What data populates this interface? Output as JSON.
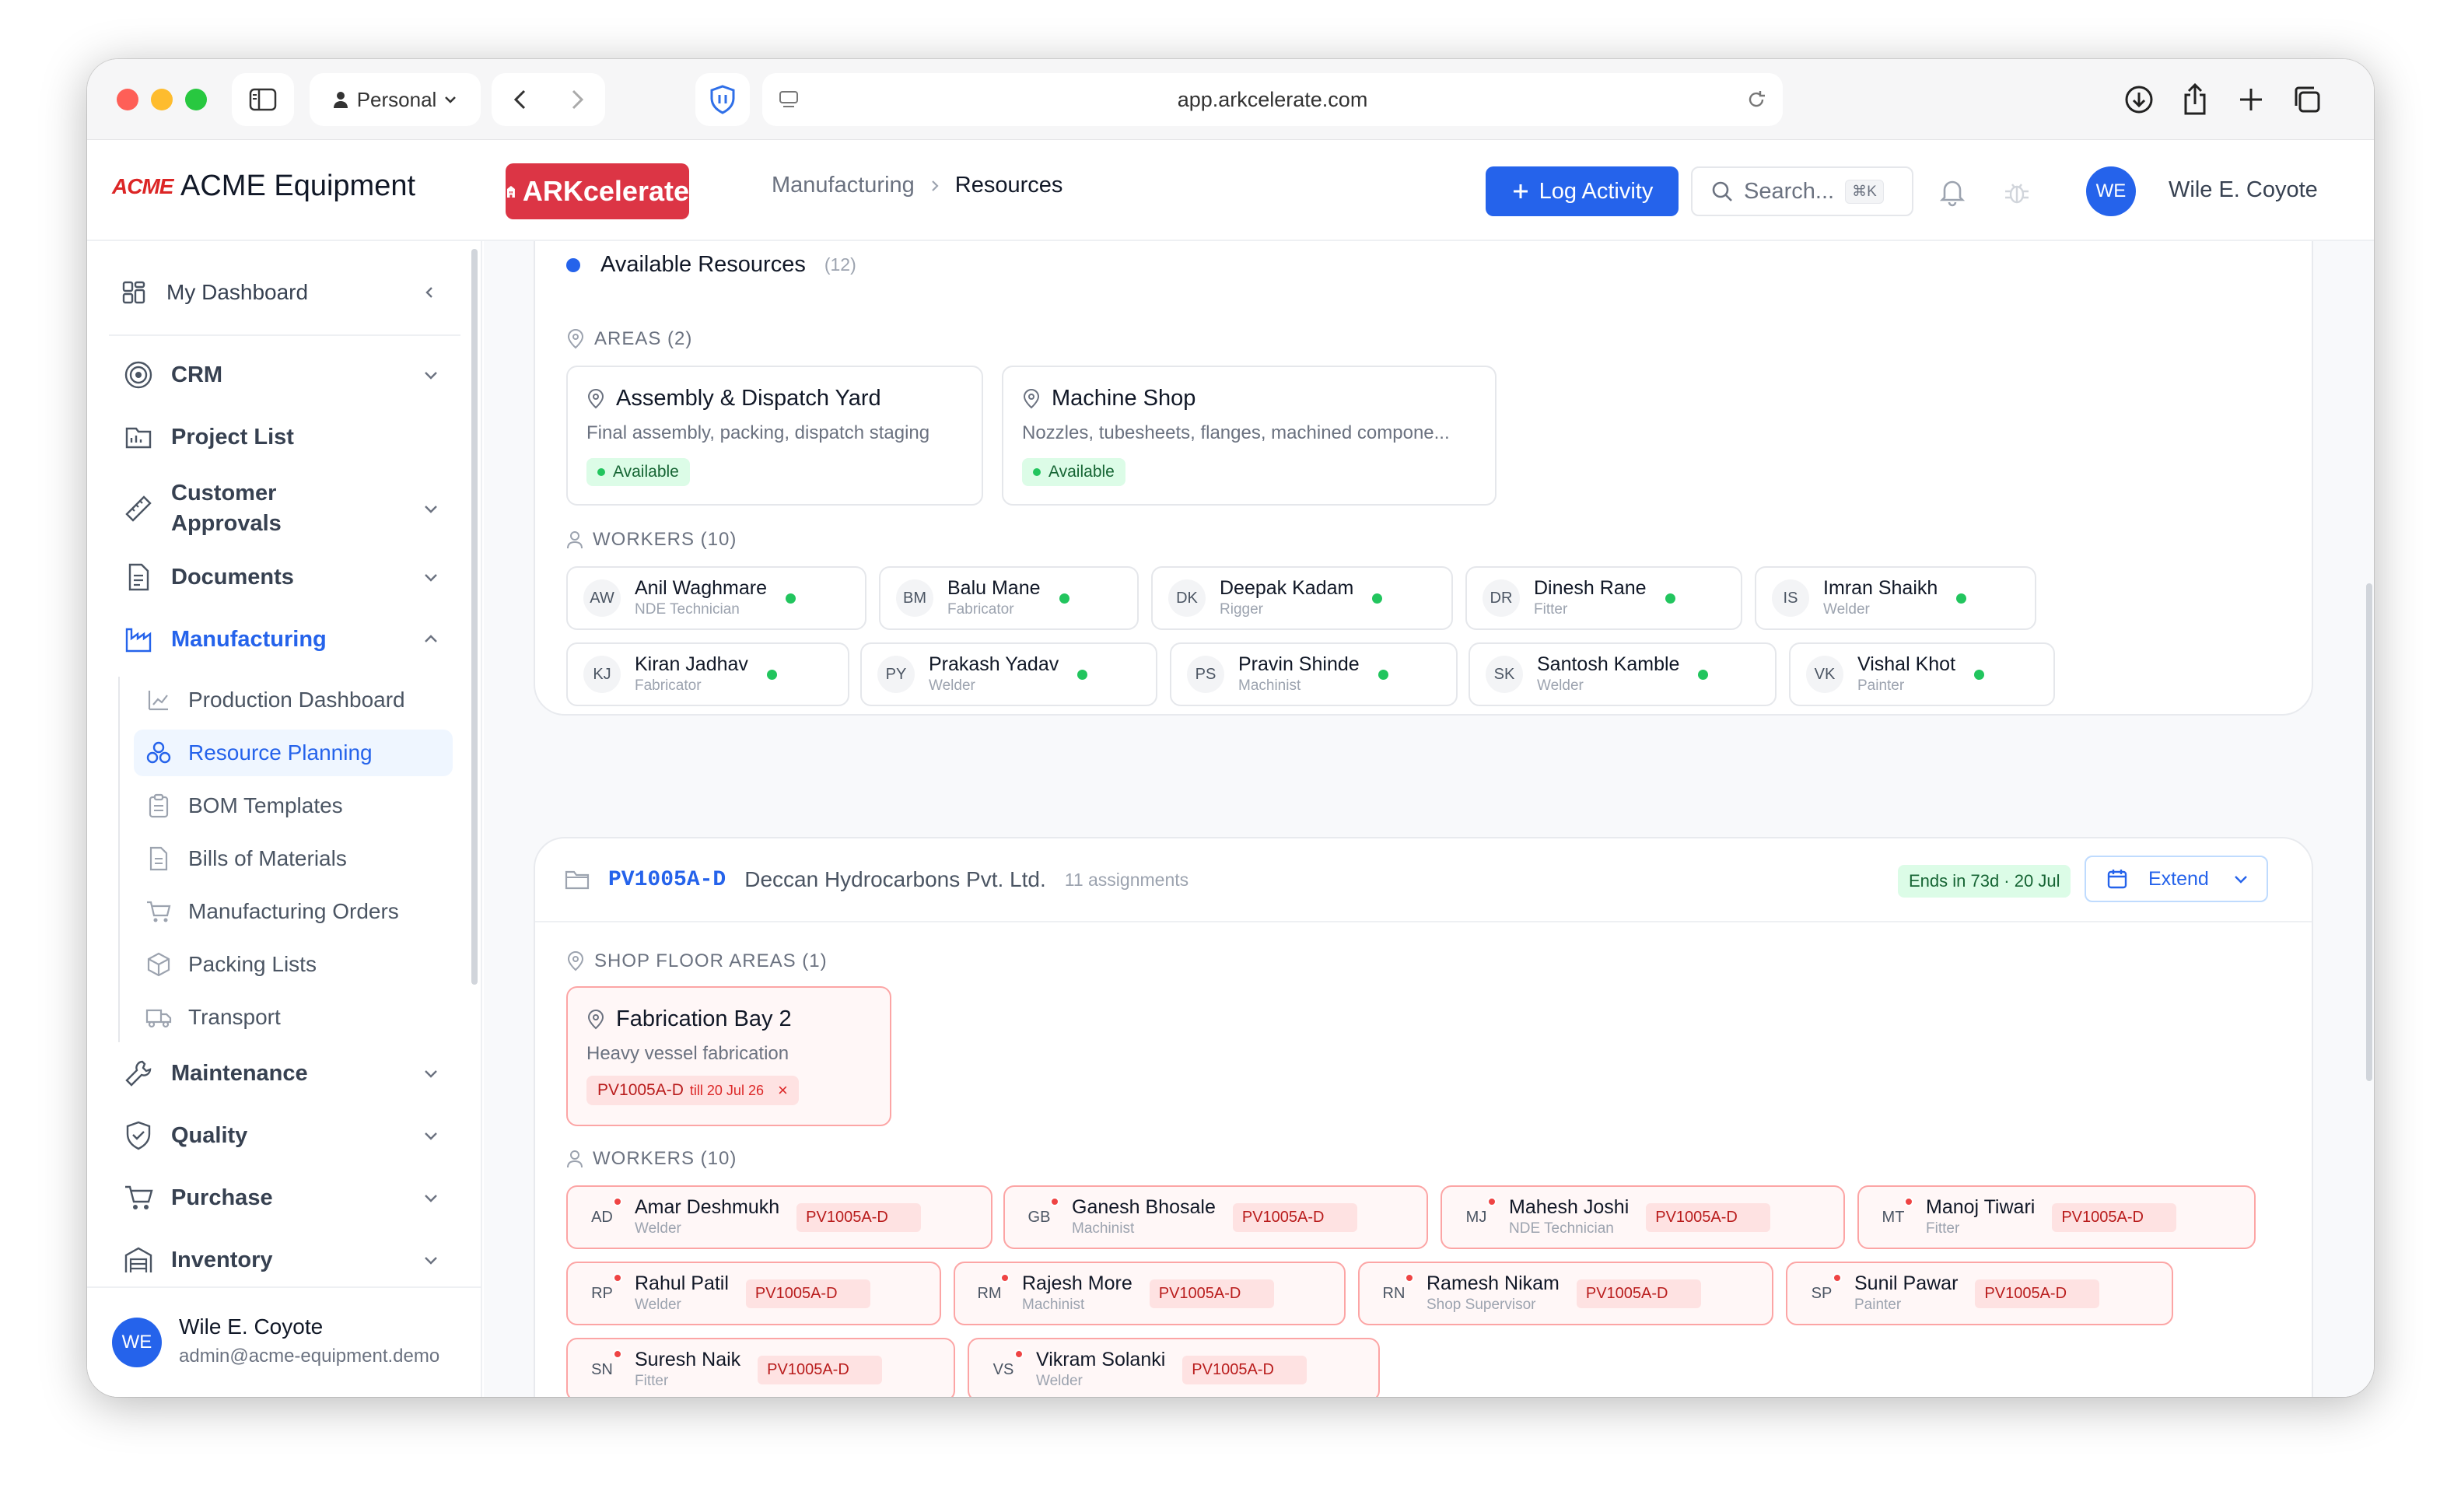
{
  "browser": {
    "profile": "Personal",
    "url": "app.arkcelerate.com"
  },
  "org": {
    "logo_text": "ACME",
    "name": "ACME Equipment"
  },
  "app": {
    "brand": "ARKcelerate",
    "brand_color": "#dc3545"
  },
  "breadcrumb": [
    "Manufacturing",
    "Resources"
  ],
  "header": {
    "log_activity_label": "Log Activity",
    "search_placeholder": "Search...",
    "search_shortcut": "⌘K",
    "user_initials": "WE",
    "user_name": "Wile E. Coyote"
  },
  "sidebar": {
    "dashboard": "My Dashboard",
    "items": [
      {
        "label": "CRM",
        "icon": "target-icon",
        "has_chevron": true
      },
      {
        "label": "Project List",
        "icon": "project-icon",
        "has_chevron": false
      },
      {
        "label": "Customer\nApprovals",
        "icon": "ruler-icon",
        "has_chevron": true
      },
      {
        "label": "Documents",
        "icon": "document-icon",
        "has_chevron": true
      },
      {
        "label": "Manufacturing",
        "icon": "factory-icon",
        "has_chevron": true,
        "expanded": true
      },
      {
        "label": "Maintenance",
        "icon": "wrench-icon",
        "has_chevron": true
      },
      {
        "label": "Quality",
        "icon": "shield-check-icon",
        "has_chevron": true
      },
      {
        "label": "Purchase",
        "icon": "cart-icon",
        "has_chevron": true
      },
      {
        "label": "Inventory",
        "icon": "warehouse-icon",
        "has_chevron": true
      }
    ],
    "manufacturing_sub": [
      {
        "label": "Production Dashboard",
        "icon": "chart-icon"
      },
      {
        "label": "Resource Planning",
        "icon": "resource-icon",
        "active": true
      },
      {
        "label": "BOM Templates",
        "icon": "clipboard-icon"
      },
      {
        "label": "Bills of Materials",
        "icon": "file-icon"
      },
      {
        "label": "Manufacturing Orders",
        "icon": "cart-icon"
      },
      {
        "label": "Packing Lists",
        "icon": "package-icon"
      },
      {
        "label": "Transport",
        "icon": "truck-icon"
      }
    ],
    "footer": {
      "initials": "WE",
      "name": "Wile E. Coyote",
      "email": "admin@acme-equipment.demo"
    }
  },
  "available": {
    "title": "Available Resources",
    "count": "(12)",
    "areas_label": "AREAS (2)",
    "areas": [
      {
        "name": "Assembly & Dispatch Yard",
        "desc": "Final assembly, packing, dispatch staging",
        "status": "Available"
      },
      {
        "name": "Machine Shop",
        "desc": "Nozzles, tubesheets, flanges, machined compone...",
        "status": "Available"
      }
    ],
    "workers_label": "WORKERS (10)",
    "workers": [
      {
        "initials": "AW",
        "name": "Anil Waghmare",
        "role": "NDE Technician"
      },
      {
        "initials": "BM",
        "name": "Balu Mane",
        "role": "Fabricator"
      },
      {
        "initials": "DK",
        "name": "Deepak Kadam",
        "role": "Rigger"
      },
      {
        "initials": "DR",
        "name": "Dinesh Rane",
        "role": "Fitter"
      },
      {
        "initials": "IS",
        "name": "Imran Shaikh",
        "role": "Welder"
      },
      {
        "initials": "KJ",
        "name": "Kiran Jadhav",
        "role": "Fabricator"
      },
      {
        "initials": "PY",
        "name": "Prakash Yadav",
        "role": "Welder"
      },
      {
        "initials": "PS",
        "name": "Pravin Shinde",
        "role": "Machinist"
      },
      {
        "initials": "SK",
        "name": "Santosh Kamble",
        "role": "Welder"
      },
      {
        "initials": "VK",
        "name": "Vishal Khot",
        "role": "Painter"
      }
    ]
  },
  "project": {
    "code": "PV1005A-D",
    "client": "Deccan Hydrocarbons Pvt. Ltd.",
    "assignments": "11 assignments",
    "ends_badge": "Ends in 73d · 20 Jul",
    "extend_label": "Extend",
    "areas_label": "SHOP FLOOR AREAS (1)",
    "area": {
      "name": "Fabrication Bay 2",
      "desc": "Heavy vessel fabrication",
      "tag_code": "PV1005A-D",
      "tag_till": "till 20 Jul 26",
      "tag_close": "×"
    },
    "workers_label": "WORKERS (10)",
    "workers": [
      {
        "initials": "AD",
        "name": "Amar Deshmukh",
        "role": "Welder",
        "tag": "PV1005A-D"
      },
      {
        "initials": "GB",
        "name": "Ganesh Bhosale",
        "role": "Machinist",
        "tag": "PV1005A-D"
      },
      {
        "initials": "MJ",
        "name": "Mahesh Joshi",
        "role": "NDE Technician",
        "tag": "PV1005A-D"
      },
      {
        "initials": "MT",
        "name": "Manoj Tiwari",
        "role": "Fitter",
        "tag": "PV1005A-D"
      },
      {
        "initials": "RP",
        "name": "Rahul Patil",
        "role": "Welder",
        "tag": "PV1005A-D"
      },
      {
        "initials": "RM",
        "name": "Rajesh More",
        "role": "Machinist",
        "tag": "PV1005A-D"
      },
      {
        "initials": "RN",
        "name": "Ramesh Nikam",
        "role": "Shop Supervisor",
        "tag": "PV1005A-D"
      },
      {
        "initials": "SP",
        "name": "Sunil Pawar",
        "role": "Painter",
        "tag": "PV1005A-D"
      },
      {
        "initials": "SN",
        "name": "Suresh Naik",
        "role": "Fitter",
        "tag": "PV1005A-D"
      },
      {
        "initials": "VS",
        "name": "Vikram Solanki",
        "role": "Welder",
        "tag": "PV1005A-D"
      }
    ]
  },
  "colors": {
    "accent": "#2563eb",
    "available_dot": "#22c55e",
    "busy_red": "#ef4444"
  }
}
